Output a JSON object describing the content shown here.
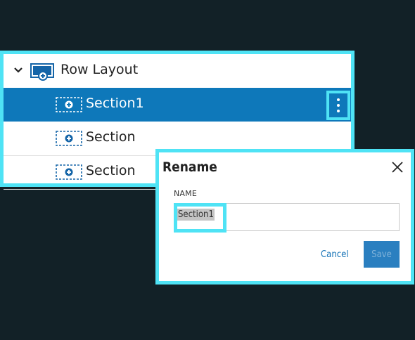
{
  "tree": {
    "root": {
      "label": "Row Layout",
      "expanded": true,
      "icon": "row-layout-icon"
    },
    "items": [
      {
        "label": "Section1",
        "selected": true,
        "icon": "section-icon"
      },
      {
        "label": "Section",
        "selected": false,
        "icon": "section-icon"
      },
      {
        "label": "Section",
        "selected": false,
        "icon": "section-icon"
      }
    ],
    "more_icon": "more-vertical-icon"
  },
  "dialog": {
    "title": "Rename",
    "field_label": "NAME",
    "field_value": "Section1",
    "cancel_label": "Cancel",
    "save_label": "Save"
  },
  "colors": {
    "background": "#122127",
    "highlight": "#4fe3f5",
    "selected_row": "#0e78ba",
    "accent_blue": "#1572b6"
  }
}
